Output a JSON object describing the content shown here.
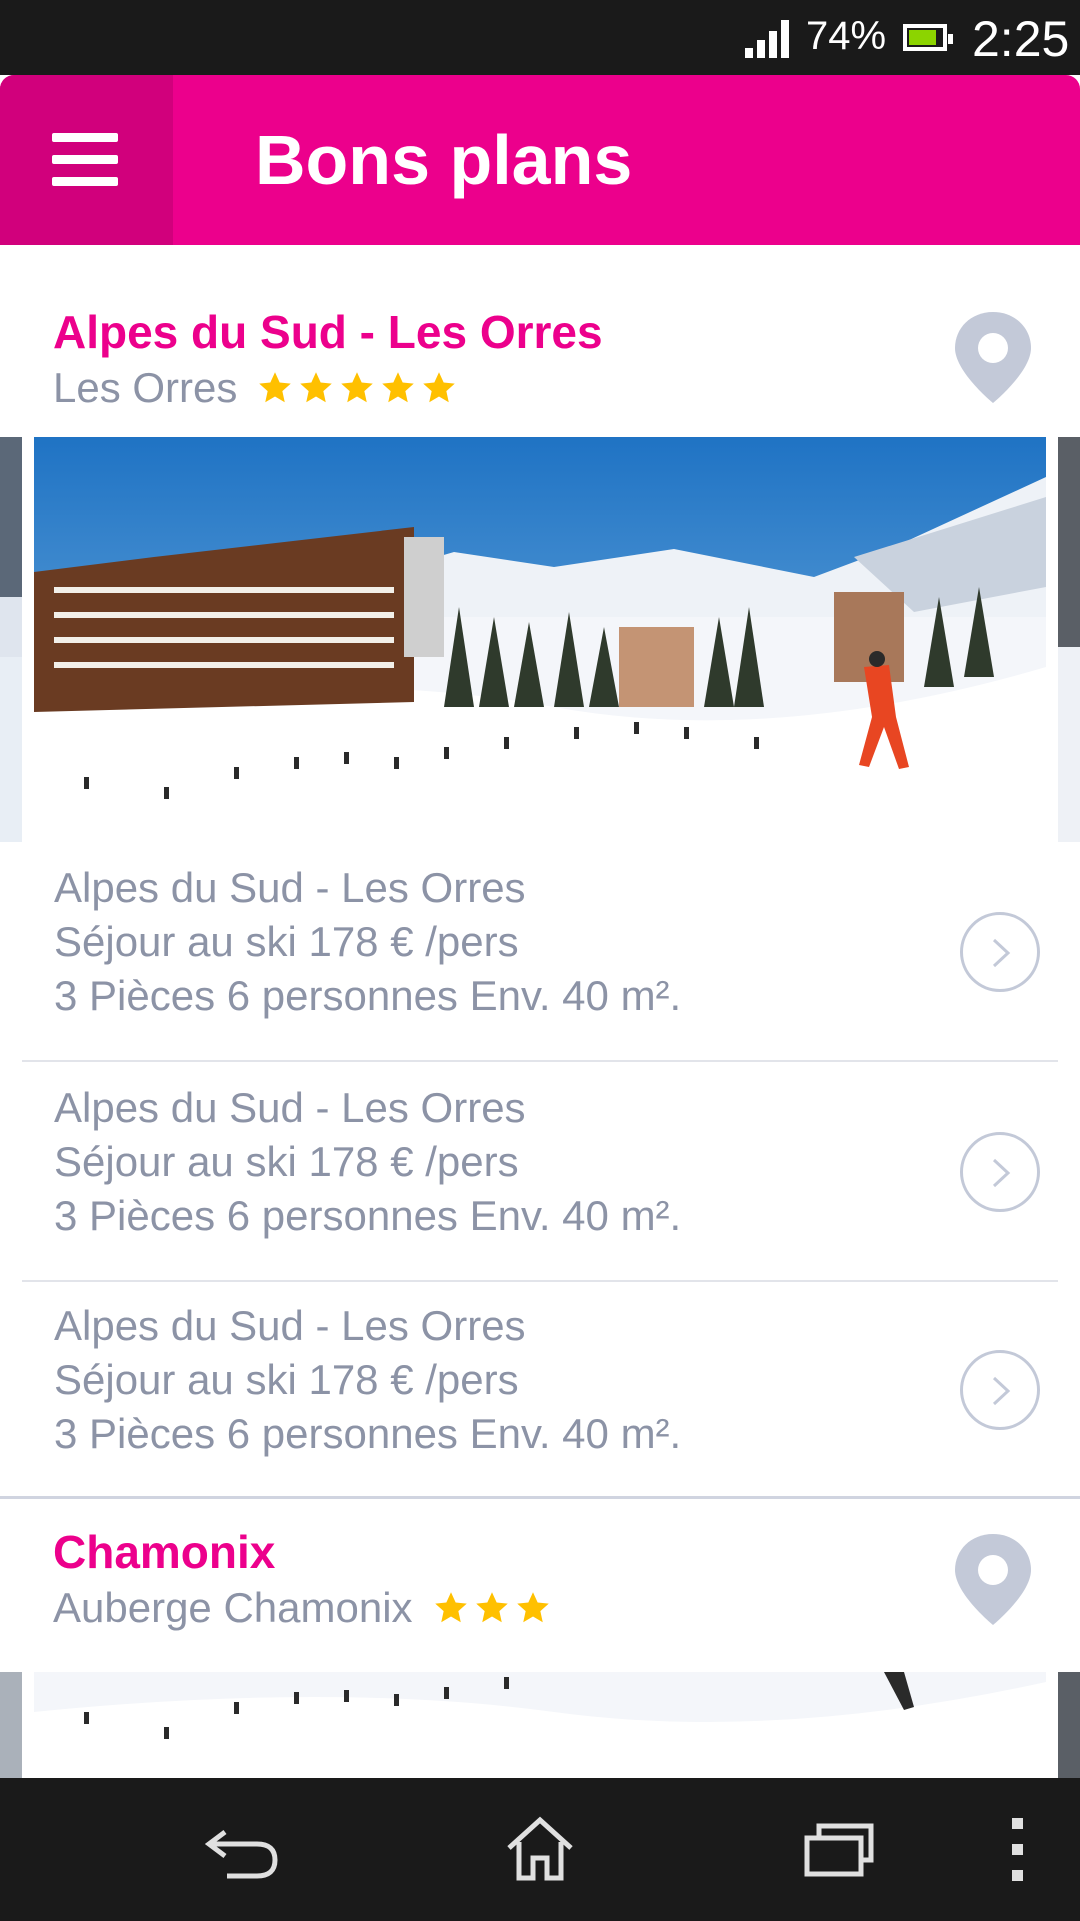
{
  "status_bar": {
    "battery_percent": "74%",
    "battery_level": 0.74,
    "time": "2:25",
    "icons": [
      "signal-icon",
      "battery-icon"
    ]
  },
  "header": {
    "title": "Bons plans",
    "menu_icon": "hamburger-menu-icon"
  },
  "listings": [
    {
      "title": "Alpes du Sud - Les Orres",
      "subtitle": "Les Orres",
      "stars": 5,
      "offers": [
        {
          "line1": "Alpes du Sud - Les Orres",
          "line2": "Séjour au ski 178 € /pers",
          "line3": "3 Pièces 6 personnes Env. 40 m²."
        },
        {
          "line1": "Alpes du Sud - Les Orres",
          "line2": "Séjour au ski 178 € /pers",
          "line3": "3 Pièces 6 personnes Env. 40 m²."
        },
        {
          "line1": "Alpes du Sud - Les Orres",
          "line2": "Séjour au ski 178 € /pers",
          "line3": "3 Pièces 6 personnes Env. 40 m²."
        }
      ]
    },
    {
      "title": "Chamonix",
      "subtitle": "Auberge Chamonix",
      "stars": 3
    }
  ],
  "colors": {
    "brand": "#ec008c",
    "brand_dark": "#d1007c",
    "star": "#ffc000",
    "text_muted": "#8c93a6",
    "icon_muted": "#c3c9d8"
  },
  "nav_bar": {
    "icons": [
      "back-icon",
      "home-icon",
      "recent-apps-icon",
      "overflow-menu-icon"
    ]
  }
}
